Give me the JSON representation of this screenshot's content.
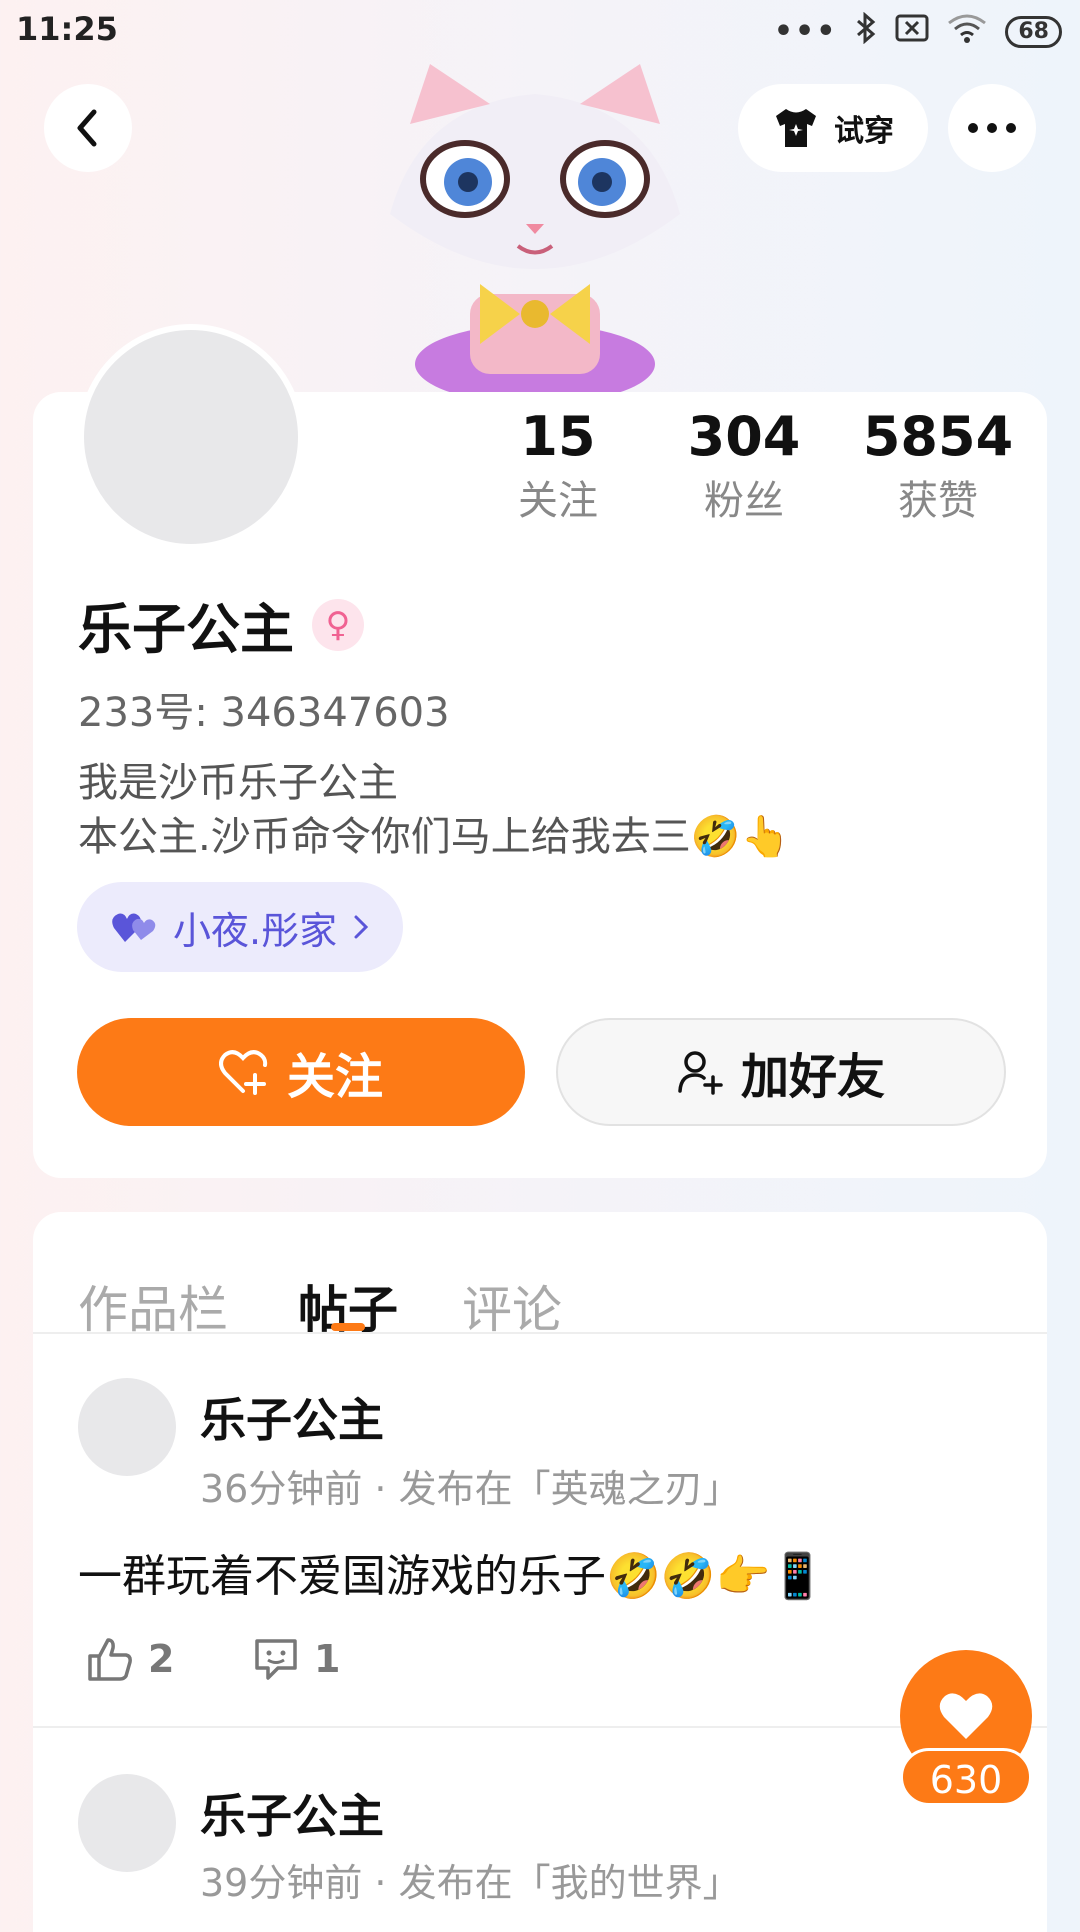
{
  "status": {
    "time": "11:25",
    "battery": "68"
  },
  "header": {
    "tryon_label": "试穿"
  },
  "stats": [
    {
      "value": "15",
      "label": "关注"
    },
    {
      "value": "304",
      "label": "粉丝"
    },
    {
      "value": "5854",
      "label": "获赞"
    }
  ],
  "profile": {
    "name": "乐子公主",
    "uid": "233号: 346347603",
    "bio_line1": "我是沙币乐子公主",
    "bio_line2": "本公主.沙币命令你们马上给我去三🤣👆",
    "tag": "小夜.彤家"
  },
  "actions": {
    "follow_label": "关注",
    "add_friend_label": "加好友"
  },
  "tabs": [
    {
      "label": "作品栏"
    },
    {
      "label": "帖子"
    },
    {
      "label": "评论"
    }
  ],
  "posts": [
    {
      "author": "乐子公主",
      "meta": "36分钟前 · 发布在「英魂之刃」",
      "text": "一群玩着不爱国游戏的乐子🤣🤣👉📱",
      "likes": "2",
      "comments": "1"
    },
    {
      "author": "乐子公主",
      "meta": "39分钟前 · 发布在「我的世界」"
    }
  ],
  "float_like": {
    "count": "630"
  },
  "colors": {
    "accent": "#fd7a16",
    "tag_text": "#5a55d9",
    "tag_bg": "#ecebfc"
  }
}
